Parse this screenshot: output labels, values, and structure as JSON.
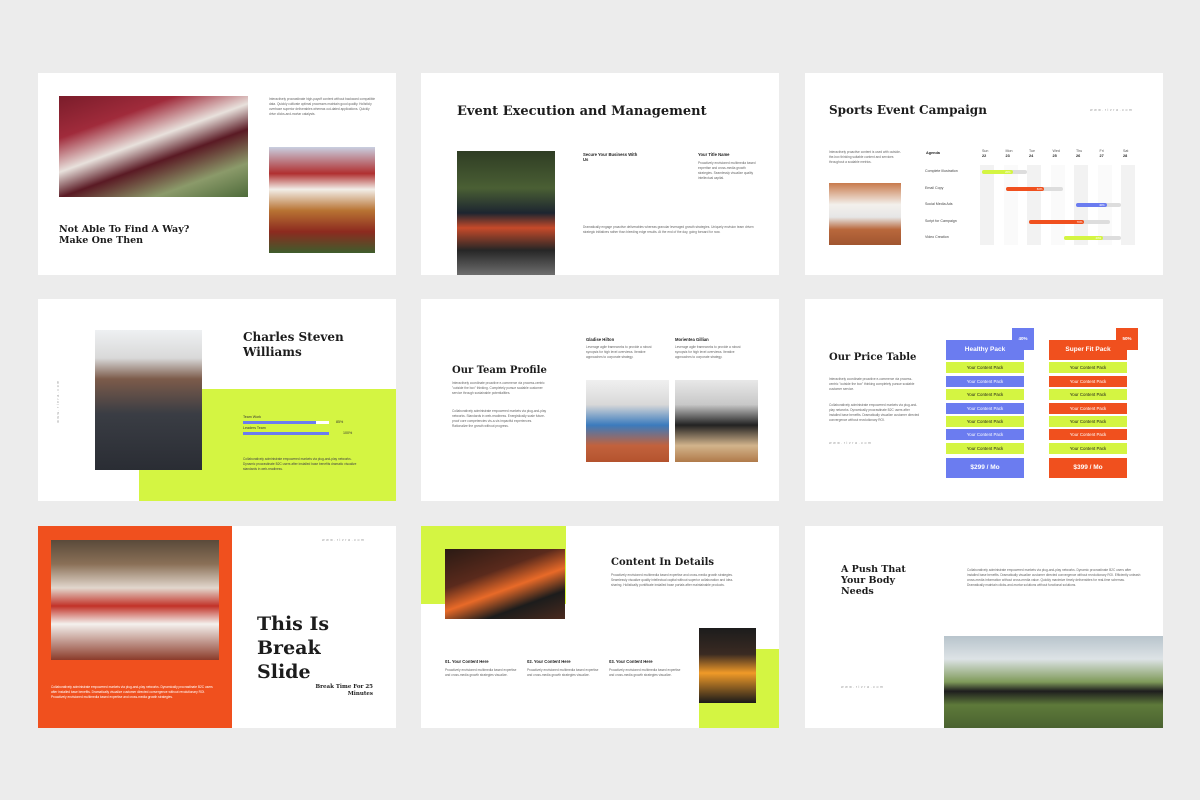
{
  "s1": {
    "title": "Not Able To Find A Way? Make One Then",
    "body": "Interactively procrastinate high-payoff content without backward compatible data. Quickly cultivate optimal processes maintain good quality. Holisticly overbaze superior deliverables whereas out-dated applications. Quickly drive clicks-and-mortar catalysts."
  },
  "s2": {
    "title": "Event Execution and Management",
    "col1_title": "Secure Your Business With Us",
    "col2_title": "Your Title Name",
    "col2_body": "Proactively envisioned multimedia based expertise and cross-media growth strategies. Seamlessly visualize quality intellectual capital.",
    "body": "Dramatically engage proactive deliverables whereas granular leveraged growth strategies. Uniquely envision team driven strategic initiatives rather than bleeding edge results. At the end of the day, going forward for now."
  },
  "s3": {
    "title": "Sports Event Campaign",
    "url": "www.rivra.com",
    "body": "Interactively proactive content is used with outside-the-box thinking suitable content and services throughout a scalable metrics.",
    "agenda_label": "Agenda",
    "days": [
      {
        "name": "Sun",
        "num": "22"
      },
      {
        "name": "Mon",
        "num": "23"
      },
      {
        "name": "Tue",
        "num": "24"
      },
      {
        "name": "Wed",
        "num": "25"
      },
      {
        "name": "Thu",
        "num": "26"
      },
      {
        "name": "Fri",
        "num": "27"
      },
      {
        "name": "Sat",
        "num": "28"
      }
    ],
    "tasks": [
      {
        "label": "Complete Illustration",
        "pct": "20%"
      },
      {
        "label": "Email Copy",
        "pct": "60%"
      },
      {
        "label": "Social Media Ads",
        "pct": "40%"
      },
      {
        "label": "Script for Campaign",
        "pct": "70%"
      },
      {
        "label": "Video Creation",
        "pct": "40%"
      }
    ]
  },
  "s4": {
    "name": "Charles Steven Williams",
    "url": "www.rivra.com",
    "skill1_label": "Team Work",
    "skill1_pct": "85%",
    "skill1_value": 0.85,
    "skill2_label": "Leaders Team",
    "skill2_pct": "100%",
    "skill2_value": 1.0,
    "body": "Collaboratively administrate empowered markets via plug-and-play networks. Dynamic procrastinate B2C users after installed base benefits dramatic visualize standards in web-readiness."
  },
  "s5": {
    "title": "Our Team Profile",
    "body1": "Interactively coordinate proactive e-commerce via process-centric \"outside the box\" thinking. Completely pursue scalable customer service through sustainable potentialities.",
    "body2": "Collaboratively administrate empowered markets via plug-and-play networks. Standards in web-readiness. Energistically scale future-proof core competencies vis-a-vis impactful experiences. Rationalize the growth without progress.",
    "member1_name": "Gladise Hilton",
    "member1_body": "Leverage agile frameworks to provide a robust synopsis for high level overviews. Iterative approaches to corporate strategy.",
    "member2_name": "Morientea Gillian",
    "member2_body": "Leverage agile frameworks to provide a robust synopsis for high level overviews. Iterative approaches to corporate strategy."
  },
  "s6": {
    "title": "Our Price Table",
    "body1": "Interactively coordinate proactive e-commerce via process-centric \"outside the box\" thinking completely pursue scalable customer service.",
    "body2": "Collaboratively administrate empowered markets via plug-and-play networks. Dynamically procrastinate B2C users after installed base benefits. Dramatically visualize customer directed convergence without revolutionary ROI.",
    "url": "www.rivra.com",
    "plan1": {
      "name": "Healthy Pack",
      "badge": "40%",
      "price": "$299 / Mo"
    },
    "plan2": {
      "name": "Super Fit Pack",
      "badge": "50%",
      "price": "$399 / Mo"
    },
    "item": "Your Content Pack"
  },
  "s7": {
    "title": "This Is Break Slide",
    "url": "www.rivra.com",
    "body": "Collaboratively administrate empowered markets via plug-and-play networks. Dynamically procrastinate B2C users after installed base benefits. Dramatically visualize customer directed convergence without revolutionary ROI. Proactively envisioned multimedia based expertise and cross-media growth strategies.",
    "break_label": "Break Time For 25 Minutes"
  },
  "s8": {
    "title": "Content In Details",
    "body": "Proactively envisioned multimedia based expertise and cross-media growth strategies. Seamlessly visualize quality intellectual capital without superior collaboration and idea-sharing. Holistically pontificate installed base portals after maintainable products.",
    "items": [
      {
        "title": "01. Your Content Here",
        "body": "Proactively envisioned multimedia based expertise and cross-media growth strategies visualize."
      },
      {
        "title": "02. Your Content Here",
        "body": "Proactively envisioned multimedia based expertise and cross-media growth strategies visualize."
      },
      {
        "title": "03. Your Content Here",
        "body": "Proactively envisioned multimedia based expertise and cross-media growth strategies visualize."
      }
    ]
  },
  "s9": {
    "title": "A Push That Your Body Needs",
    "body": "Collaboratively administrate empowered markets via plug-and-play networks. Dynamic procrastinate B2C users after installed base benefits. Dramatically visualize customer directed convergence without revolutionary ROI. Efficiently unleash cross-media information without cross-media value. Quickly maximize timely deliverables for real-time schemas. Dramatically maintain clicks-and-mortar solutions without functional solutions.",
    "url": "www.rivra.com"
  },
  "colors": {
    "lime": "#d4f542",
    "orange": "#f0501e",
    "blue": "#6b7cf0"
  }
}
